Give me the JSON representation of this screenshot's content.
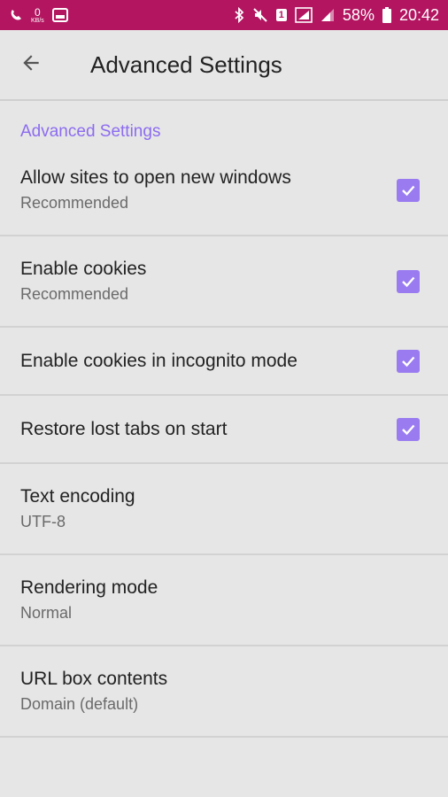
{
  "status_bar": {
    "net_speed": "0",
    "net_unit": "KB/s",
    "sim_slot": "1",
    "battery": "58%",
    "time": "20:42"
  },
  "toolbar": {
    "title": "Advanced Settings"
  },
  "section": {
    "header": "Advanced Settings"
  },
  "settings": [
    {
      "label": "Allow sites to open new windows",
      "sub": "Recommended",
      "checked": true
    },
    {
      "label": "Enable cookies",
      "sub": "Recommended",
      "checked": true
    },
    {
      "label": "Enable cookies in incognito mode",
      "checked": true
    },
    {
      "label": "Restore lost tabs on start",
      "checked": true
    },
    {
      "label": "Text encoding",
      "sub": "UTF-8"
    },
    {
      "label": "Rendering mode",
      "sub": "Normal"
    },
    {
      "label": "URL box contents",
      "sub": "Domain (default)"
    }
  ],
  "colors": {
    "status_bar": "#b31560",
    "accent": "#8c6cf0",
    "checkbox": "#9a7cf0",
    "background": "#e6e6e6"
  }
}
